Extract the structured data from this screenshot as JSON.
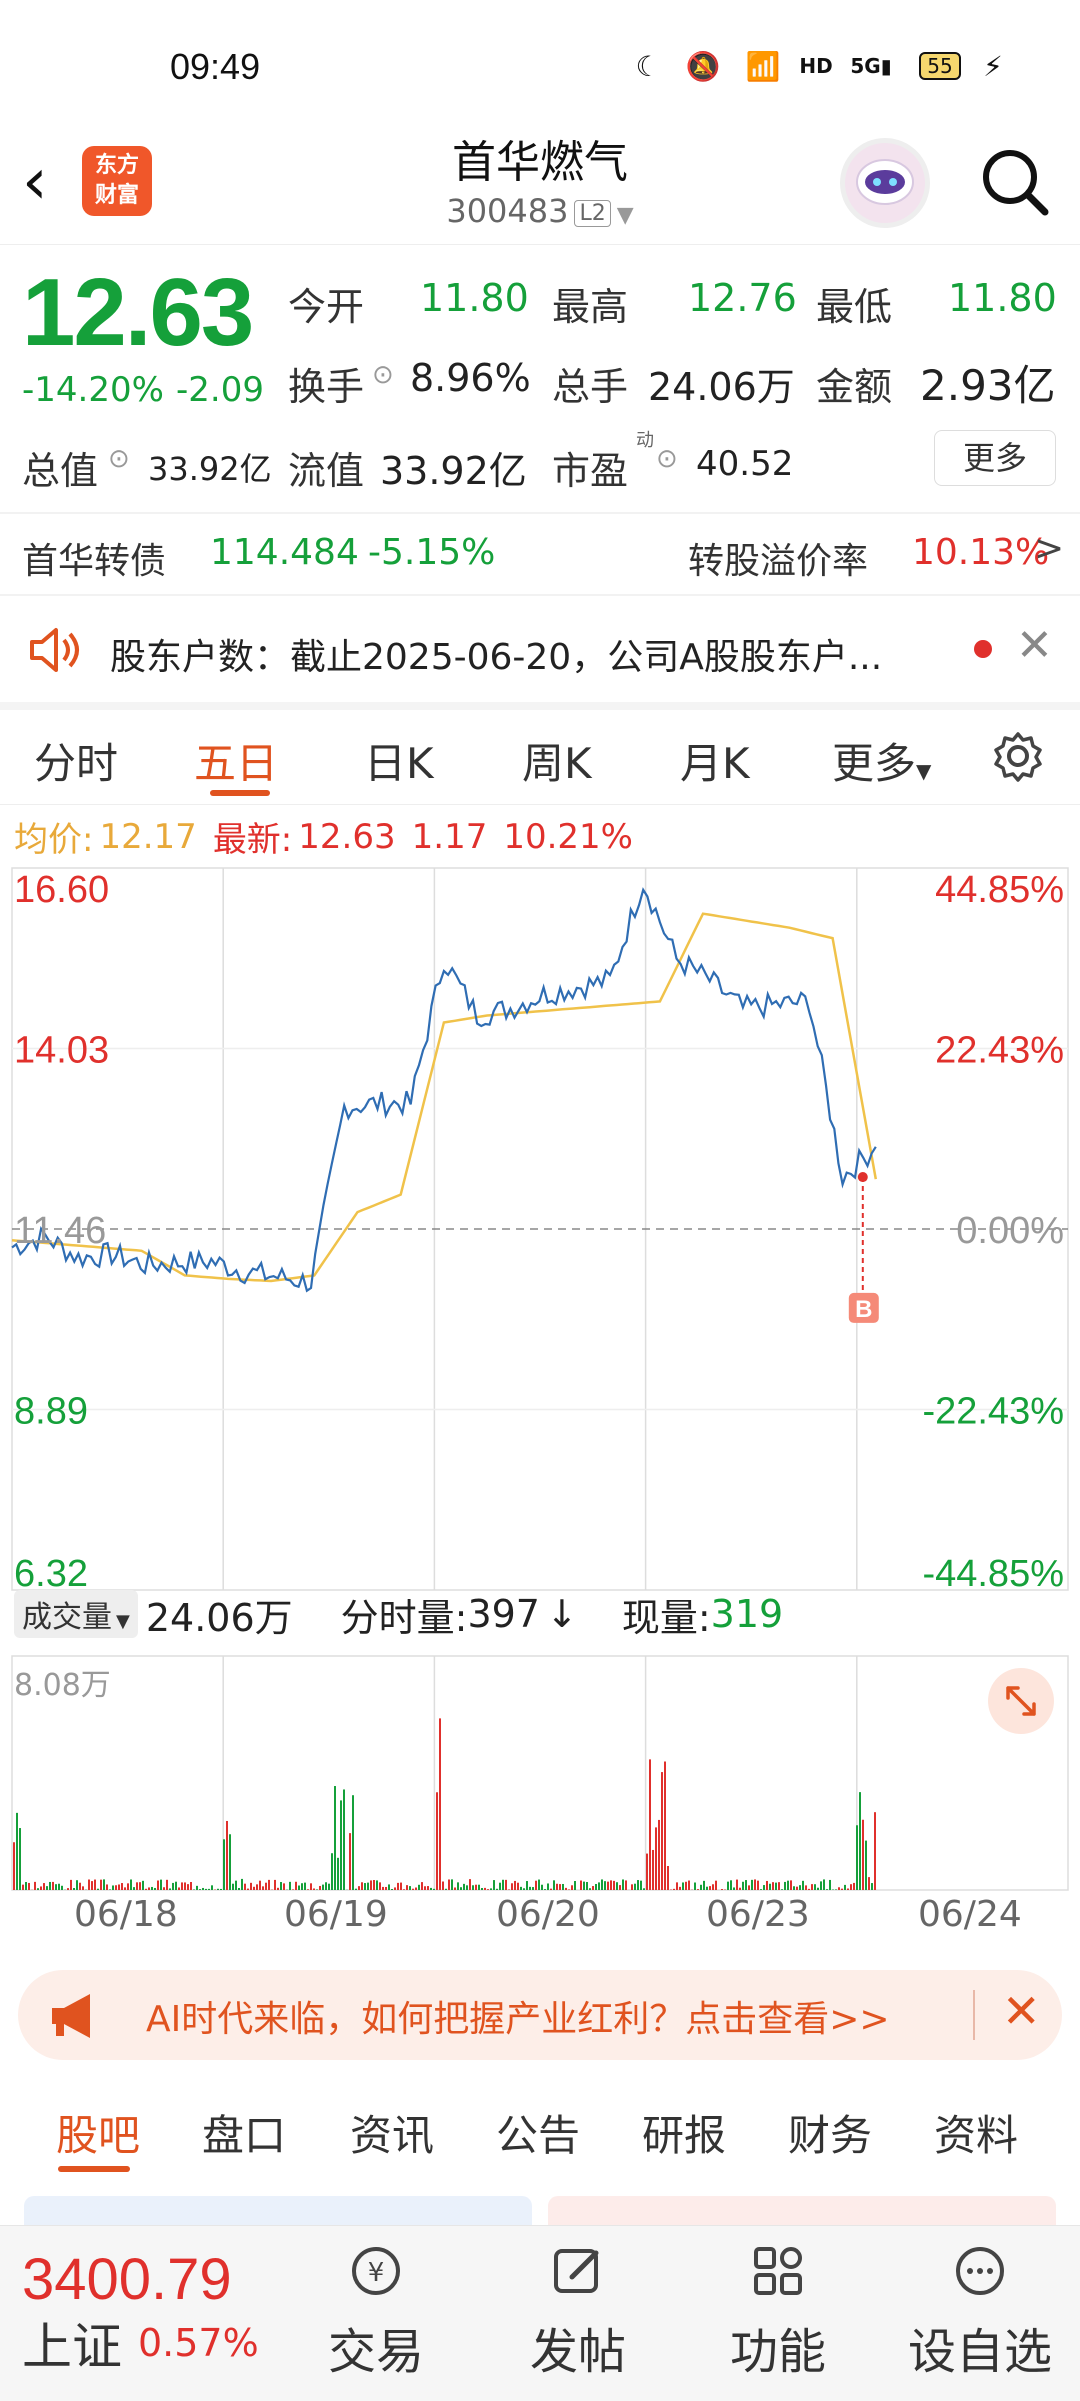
{
  "status": {
    "time": "09:49",
    "battery": "55"
  },
  "header": {
    "name": "首华燃气",
    "code": "300483",
    "level": "L2",
    "logo_text": "东方财富"
  },
  "quote": {
    "price": "12.63",
    "change_pct": "-14.20%",
    "change": "-2.09",
    "open_label": "今开",
    "open": "11.80",
    "high_label": "最高",
    "high": "12.76",
    "low_label": "最低",
    "low": "11.80",
    "turnover_label": "换手",
    "turnover": "8.96%",
    "volume_label": "总手",
    "volume": "24.06万",
    "amount_label": "金额",
    "amount": "2.93亿",
    "mktcap_label": "总值",
    "mktcap": "33.92亿",
    "float_label": "流值",
    "float": "33.92亿",
    "pe_label": "市盈",
    "pe_sup": "动",
    "pe": "40.52",
    "more": "更多"
  },
  "bond": {
    "name": "首华转债",
    "price": "114.484",
    "pct": "-5.15%",
    "premium_label": "转股溢价率",
    "premium": "10.13%",
    "arrow": ">"
  },
  "notice": {
    "text": "股东户数：截止2025-06-20，公司A股股东户..."
  },
  "tabs": [
    "分时",
    "五日",
    "日K",
    "周K",
    "月K",
    "更多"
  ],
  "info": {
    "avg_label": "均价:",
    "avg": "12.17",
    "latest_label": "最新:",
    "latest": "12.63",
    "chg": "1.17",
    "pct": "10.21%"
  },
  "chart_data": {
    "type": "line",
    "title": "",
    "y_left_ticks": [
      "16.60",
      "14.03",
      "11.46",
      "8.89",
      "6.32"
    ],
    "y_right_ticks": [
      "44.85%",
      "22.43%",
      "0.00%",
      "-22.43%",
      "-44.85%"
    ],
    "x": [
      "06/18",
      "06/19",
      "06/20",
      "06/23",
      "06/24"
    ],
    "ylim": [
      6.32,
      16.6
    ],
    "baseline": 11.46,
    "series": [
      {
        "name": "",
        "values": [
          11.2,
          11.35,
          11.05,
          11.1,
          10.95,
          10.98,
          11.0,
          10.85,
          10.78,
          10.7,
          13.2,
          13.25,
          13.25,
          15.3,
          14.5,
          14.6,
          14.8,
          14.9,
          15.0,
          16.4,
          15.3,
          15.0,
          14.6,
          14.65,
          14.7,
          12.2,
          12.63
        ]
      },
      {
        "name": "",
        "values": [
          11.3,
          11.25,
          11.2,
          11.15,
          10.8,
          10.75,
          10.72,
          10.8,
          11.7,
          11.95,
          14.4,
          14.5,
          14.55,
          14.6,
          14.65,
          14.7,
          15.95,
          15.85,
          15.75,
          15.6,
          12.17
        ]
      }
    ],
    "volume_max_label": "8.08万",
    "marker": "B"
  },
  "volume": {
    "label": "成交量",
    "total": "24.06万",
    "tick_label": "分时量:",
    "tick": "397",
    "tick_arrow": "↓",
    "now_label": "现量:",
    "now": "319"
  },
  "banner": {
    "text": "AI时代来临，如何把握产业红利？点击查看>>"
  },
  "bottom_tabs": [
    "股吧",
    "盘口",
    "资讯",
    "公告",
    "研报",
    "财务",
    "资料"
  ],
  "index": {
    "value": "3400.79",
    "name": "上证",
    "pct": "0.57%"
  },
  "bottom_nav": [
    "交易",
    "发帖",
    "功能",
    "设自选"
  ],
  "colors": {
    "up": "#e0302c",
    "down": "#15a03a",
    "accent": "#e0531f",
    "line": "#2f6db3",
    "avg": "#f0c24a"
  }
}
